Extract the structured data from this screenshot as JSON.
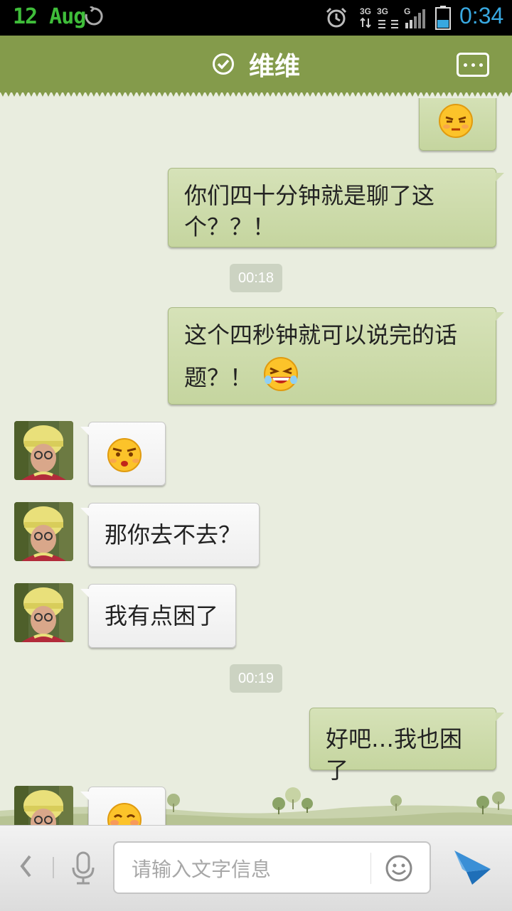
{
  "status_bar": {
    "date": "12 Aug",
    "time": "0:34",
    "network_labels": [
      "3G",
      "3G",
      "G"
    ],
    "icons": [
      "sync-icon",
      "alarm-icon",
      "signal-icon",
      "battery-icon"
    ]
  },
  "header": {
    "title": "维维",
    "status_icon": "check-circle-icon",
    "more_icon": "more-dots-icon",
    "color": "#849b4b"
  },
  "messages": [
    {
      "side": "out",
      "type": "emoji",
      "emoji": "annoyed-face-icon"
    },
    {
      "side": "out",
      "type": "text",
      "lines": [
        "你们四十分钟就是聊了这",
        "个？？！"
      ]
    },
    {
      "side": "time",
      "text": "00:18"
    },
    {
      "side": "out",
      "type": "text",
      "lines": [
        "这个四秒钟就可以说完的话",
        "题？！"
      ],
      "emoji": "laughing-face-icon"
    },
    {
      "side": "in",
      "type": "emoji",
      "emoji": "smug-face-icon"
    },
    {
      "side": "in",
      "type": "text",
      "lines": [
        "那你去不去？"
      ]
    },
    {
      "side": "in",
      "type": "text",
      "lines": [
        "我有点困了"
      ]
    },
    {
      "side": "time",
      "text": "00:19"
    },
    {
      "side": "out",
      "type": "text",
      "lines": [
        "好吧…我也困了"
      ]
    },
    {
      "side": "in",
      "type": "emoji",
      "emoji": "blush-face-icon"
    }
  ],
  "input_bar": {
    "placeholder": "请输入文字信息",
    "icons": [
      "back-chevron-icon",
      "microphone-icon",
      "smiley-icon",
      "send-plane-icon"
    ]
  },
  "colors": {
    "out_bubble": "#cddaab",
    "in_bubble": "#f5f5f5",
    "chat_bg": "#e9eddf",
    "time_color": "#38a8e0",
    "date_color": "#3fbd3a"
  }
}
